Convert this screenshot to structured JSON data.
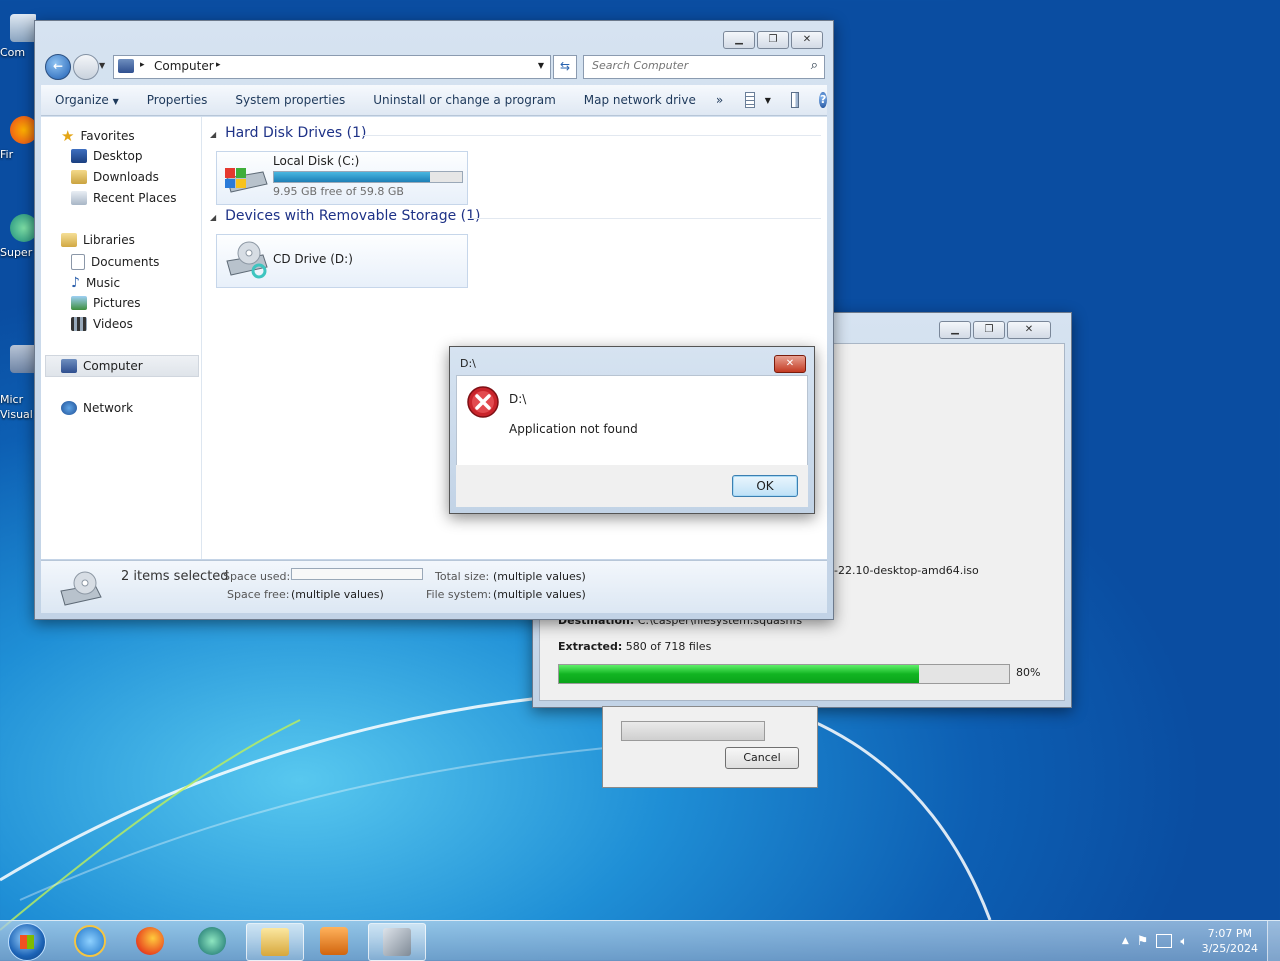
{
  "desktop": {
    "icons": [
      {
        "label": "Com"
      },
      {
        "label": "Fir"
      },
      {
        "label": "Super"
      },
      {
        "label": "Micr\nVisual"
      }
    ]
  },
  "explorer": {
    "address": {
      "root": "Computer",
      "sep": "▸"
    },
    "search": {
      "placeholder": "Search Computer"
    },
    "toolbar": {
      "organize": "Organize",
      "properties": "Properties",
      "system_properties": "System properties",
      "uninstall": "Uninstall or change a program",
      "map_drive": "Map network drive",
      "more": "»"
    },
    "nav": {
      "favorites": "Favorites",
      "desktop": "Desktop",
      "downloads": "Downloads",
      "recent": "Recent Places",
      "libraries": "Libraries",
      "documents": "Documents",
      "music": "Music",
      "pictures": "Pictures",
      "videos": "Videos",
      "computer": "Computer",
      "network": "Network"
    },
    "groups": {
      "hdd": "Hard Disk Drives (1)",
      "removable": "Devices with Removable Storage (1)"
    },
    "drives": {
      "c": {
        "name": "Local Disk (C:)",
        "free_text": "9.95 GB free of 59.8 GB",
        "used_fraction": 0.83
      },
      "d": {
        "name": "CD Drive (D:)"
      }
    },
    "status": {
      "selected": "2 items selected",
      "space_used_label": "Space used:",
      "space_free_label": "Space free:",
      "space_free": "(multiple values)",
      "total_size_label": "Total size:",
      "total_size": "(multiple values)",
      "file_system_label": "File system:",
      "file_system": "(multiple values)"
    }
  },
  "extract": {
    "iso": "-22.10-desktop-amd64.iso",
    "destination_label": "Destination:",
    "destination": "C:\\casper\\filesystem.squashfs",
    "extracted_label": "Extracted:",
    "extracted": "580 of 718 files",
    "progress_fraction": 0.8,
    "percent_text": "80%",
    "cancel": "Cancel"
  },
  "dialog": {
    "title": "D:\\",
    "heading": "D:\\",
    "message": "Application not found",
    "ok": "OK"
  },
  "clock": {
    "time": "7:07 PM",
    "date": "3/25/2024"
  },
  "colors": {
    "progress_green": "#1fc22f",
    "error_red": "#c9242b",
    "link_blue": "#1e3287"
  }
}
